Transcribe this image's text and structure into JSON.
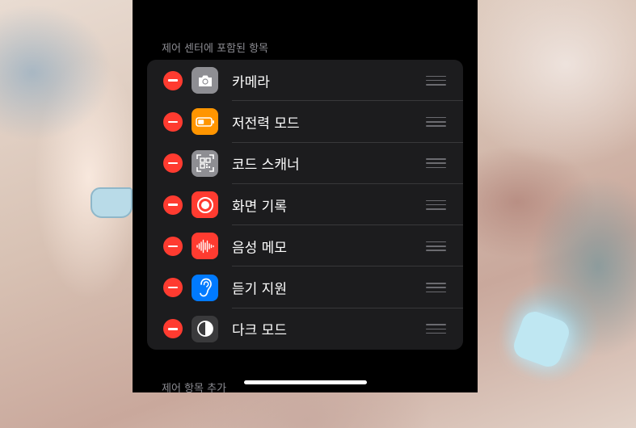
{
  "included_section": {
    "header": "제어 센터에 포함된 항목",
    "items": [
      {
        "label": "카메라",
        "icon": "camera-icon",
        "icon_color": "#8e8e93"
      },
      {
        "label": "저전력 모드",
        "icon": "battery-icon",
        "icon_color": "#ff9500"
      },
      {
        "label": "코드 스캐너",
        "icon": "qr-code-icon",
        "icon_color": "#8e8e93"
      },
      {
        "label": "화면 기록",
        "icon": "screen-record-icon",
        "icon_color": "#ff3b30"
      },
      {
        "label": "음성 메모",
        "icon": "waveform-icon",
        "icon_color": "#ff3b30"
      },
      {
        "label": "듣기 지원",
        "icon": "ear-icon",
        "icon_color": "#007aff"
      },
      {
        "label": "다크 모드",
        "icon": "dark-mode-icon",
        "icon_color": "#3a3a3c"
      }
    ]
  },
  "more_section": {
    "header": "제어 항목 추가"
  },
  "colors": {
    "remove": "#ff3b30",
    "panel": "#000000",
    "list_bg": "#1c1c1e"
  }
}
